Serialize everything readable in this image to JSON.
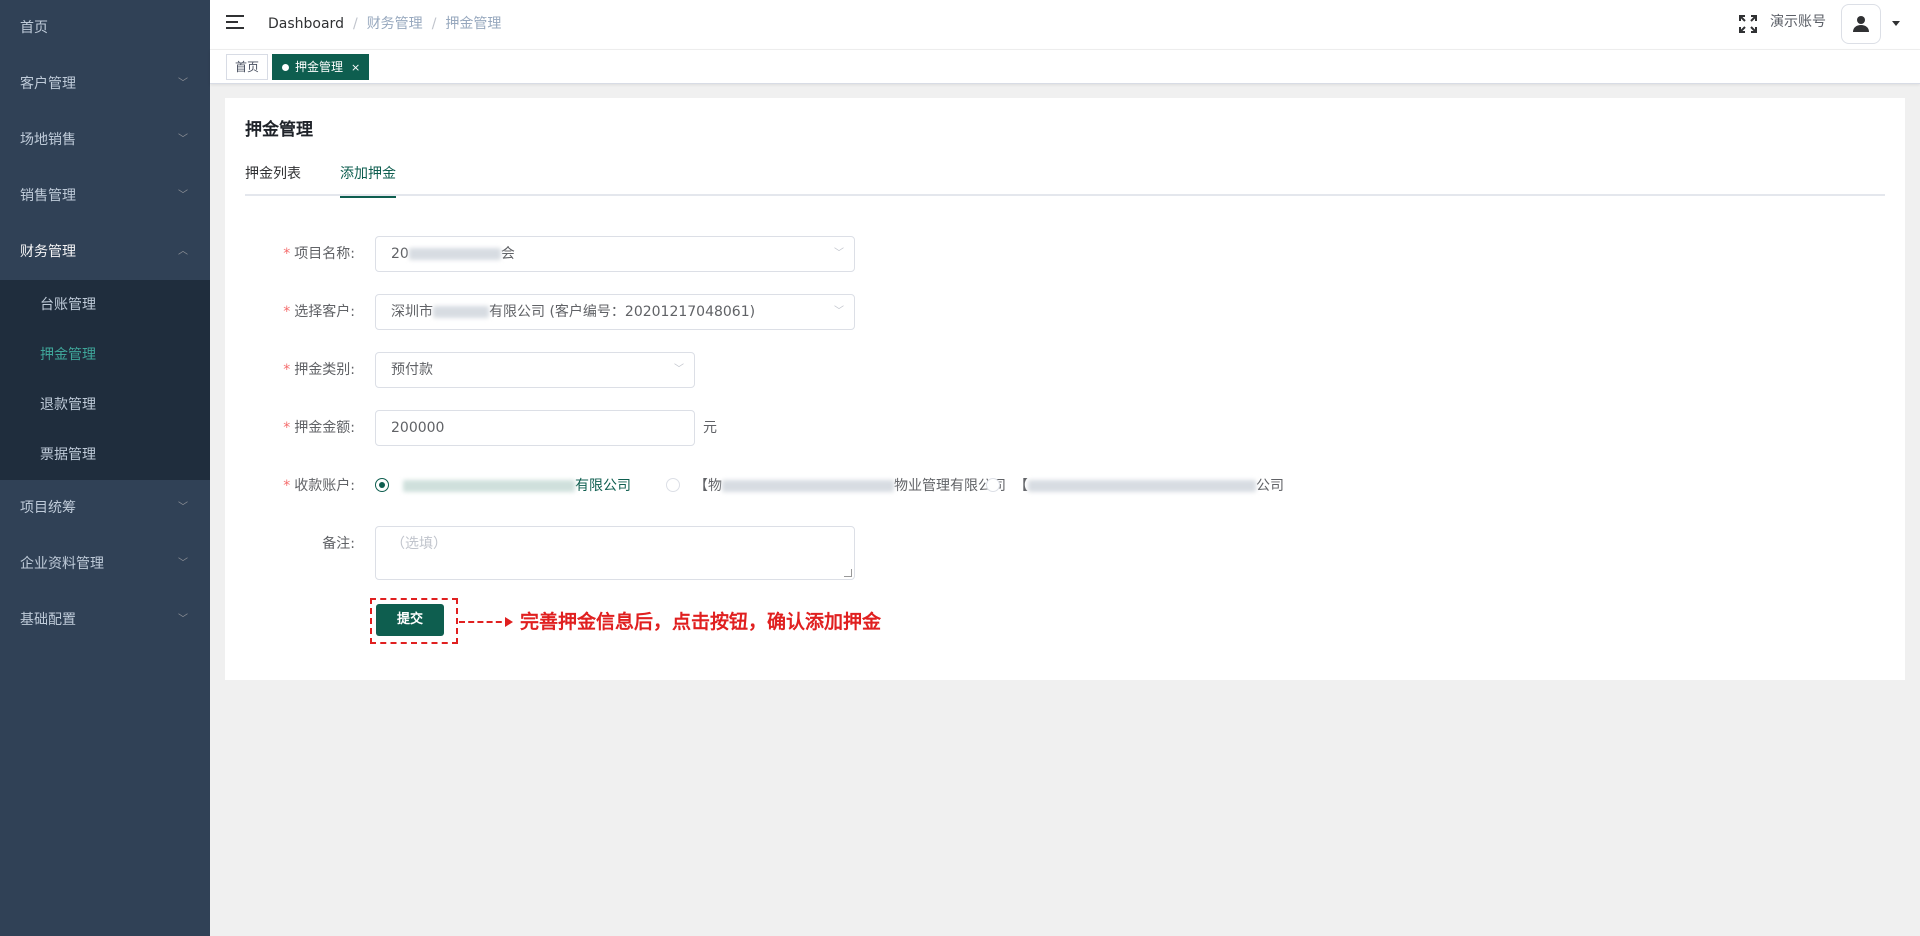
{
  "sidebar": {
    "items": [
      {
        "label": "首页"
      },
      {
        "label": "客户管理"
      },
      {
        "label": "场地销售"
      },
      {
        "label": "销售管理"
      },
      {
        "label": "财务管理"
      },
      {
        "label": "项目统筹"
      },
      {
        "label": "企业资料管理"
      },
      {
        "label": "基础配置"
      }
    ],
    "finance_sub": [
      {
        "label": "台账管理"
      },
      {
        "label": "押金管理"
      },
      {
        "label": "退款管理"
      },
      {
        "label": "票据管理"
      }
    ]
  },
  "header": {
    "breadcrumb": [
      "Dashboard",
      "财务管理",
      "押金管理"
    ],
    "account": "演示账号"
  },
  "tags": {
    "home": "首页",
    "active": "押金管理",
    "close": "×"
  },
  "page": {
    "title": "押金管理",
    "tabs": [
      "押金列表",
      "添加押金"
    ],
    "active_tab": "添加押金"
  },
  "form": {
    "project_label": "项目名称:",
    "project_value_prefix": "20",
    "project_value_suffix": "会",
    "customer_label": "选择客户:",
    "customer_value_prefix": "深圳市",
    "customer_value_suffix": "有限公司 (客户编号：20201217048061)",
    "deposit_type_label": "押金类别:",
    "deposit_type_value": "预付款",
    "amount_label": "押金金额:",
    "amount_value": "200000",
    "amount_unit": "元",
    "account_label": "收款账户:",
    "accounts": [
      {
        "prefix": "",
        "suffix": "有限公司",
        "checked": true
      },
      {
        "prefix": "【物",
        "suffix": "物业管理有限公司",
        "checked": false
      },
      {
        "prefix": "【",
        "suffix": "公司",
        "checked": false
      }
    ],
    "remark_label": "备注:",
    "remark_placeholder": "（选填）",
    "submit_label": "提交"
  },
  "annotation": {
    "text": "完善押金信息后，点击按钮，确认添加押金"
  },
  "colors": {
    "primary": "#0e5e4f",
    "sidebar_bg": "#304156",
    "sidebar_sub_bg": "#1f2d3d",
    "annotation": "#e02020",
    "required": "#f56c6c"
  }
}
